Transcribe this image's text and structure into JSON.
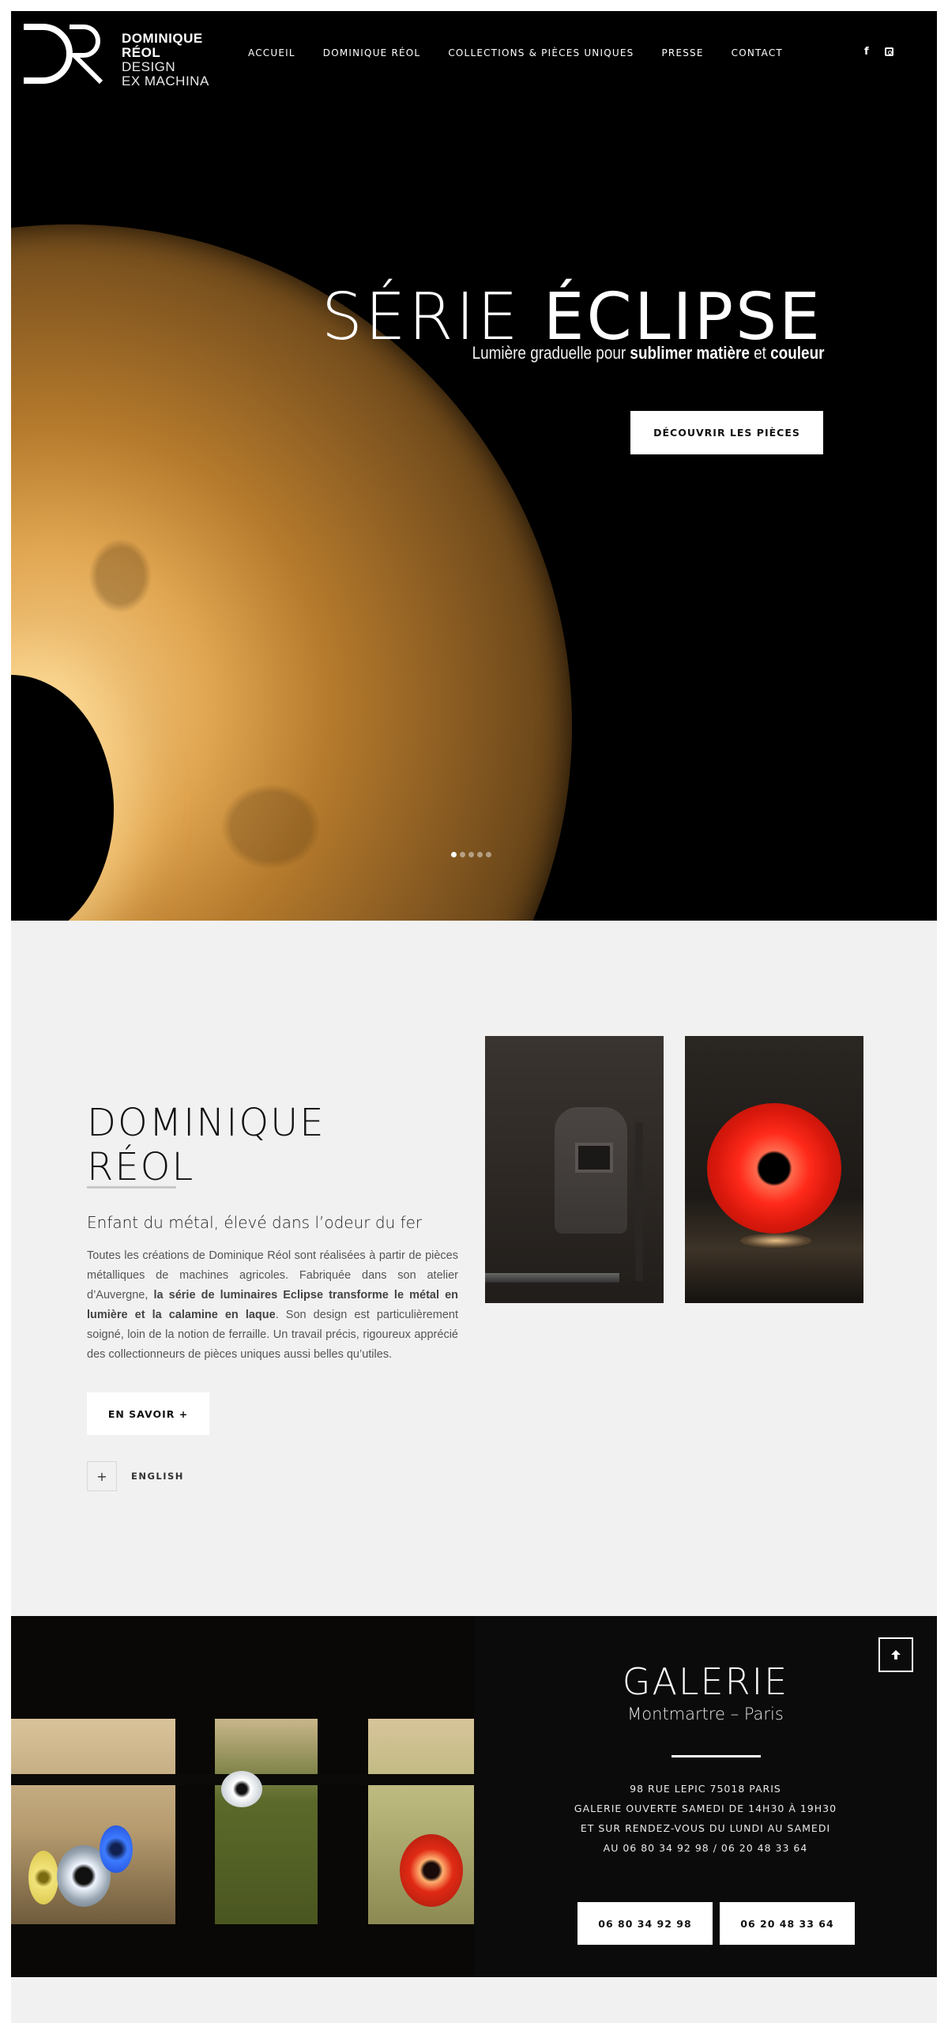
{
  "header": {
    "logo": {
      "line1": "DOMINIQUE",
      "line2": "RÉOL",
      "line3": "DESIGN",
      "line4": "EX MACHINA"
    },
    "nav": [
      {
        "label": "ACCUEIL"
      },
      {
        "label": "DOMINIQUE RÉOL"
      },
      {
        "label": "COLLECTIONS & PIÈCES UNIQUES"
      },
      {
        "label": "PRESSE"
      },
      {
        "label": "CONTACT"
      }
    ],
    "social": {
      "facebook_glyph": "f",
      "facebook_icon": "facebook-icon",
      "instagram_icon": "instagram-icon"
    }
  },
  "hero": {
    "title_light": "SÉRIE",
    "title_strong": "ÉCLIPSE",
    "subtitle_parts": {
      "p1": "Lumière graduelle pour ",
      "b1": "sublimer matière",
      "p2": " et ",
      "b2": "couleur"
    },
    "cta": "DÉCOUVRIR LES PIÈCES",
    "slider": {
      "total": 5,
      "active": 1
    }
  },
  "about": {
    "title_line1": "DOMINIQUE",
    "title_line2": "RÉOL",
    "subtitle": "Enfant du métal, élevé dans l’odeur du fer",
    "text": {
      "p1": "Toutes les créations de Dominique Réol sont réalisées à partir de pièces métalliques de machines agricoles. Fabriquée dans son atelier d’Auvergne, ",
      "b1": "la série de luminaires Eclipse transforme le métal en lumière et la calamine en laque",
      "p2": ". Son design est particulièrement soigné, loin de la notion de ferraille. Un travail précis, rigoureux apprécié des collectionneurs de pièces uniques aussi belles qu’utiles."
    },
    "more_button": "EN SAVOIR +",
    "lang_toggle": "+",
    "lang_label": "ENGLISH",
    "photos": [
      {
        "subject": "welding mask in workshop"
      },
      {
        "subject": "red Eclipse lamp in workshop"
      }
    ]
  },
  "gallery": {
    "title": "GALERIE",
    "subtitle": "Montmartre – Paris",
    "address_lines": [
      "98 RUE LEPIC 75018 PARIS",
      "GALERIE OUVERTE SAMEDI DE 14H30 À 19H30",
      "ET SUR RENDEZ-VOUS DU LUNDI AU SAMEDI",
      "AU 06 80 34 92 98 / 06 20 48 33 64"
    ],
    "phones": [
      "06 80 34 92 98",
      "06 20 48 33 64"
    ],
    "photo": {
      "subject": "gallery storefront at night with lit Eclipse lamps"
    }
  },
  "back_to_top": {
    "icon": "arrow-up-icon",
    "glyph": "🡑"
  }
}
